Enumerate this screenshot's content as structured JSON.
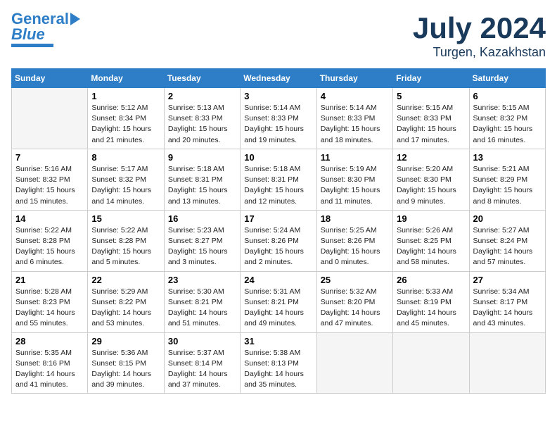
{
  "header": {
    "logo_line1": "General",
    "logo_line2": "Blue",
    "title": "July 2024",
    "subtitle": "Turgen, Kazakhstan"
  },
  "columns": [
    "Sunday",
    "Monday",
    "Tuesday",
    "Wednesday",
    "Thursday",
    "Friday",
    "Saturday"
  ],
  "weeks": [
    [
      {
        "day": "",
        "info": ""
      },
      {
        "day": "1",
        "info": "Sunrise: 5:12 AM\nSunset: 8:34 PM\nDaylight: 15 hours\nand 21 minutes."
      },
      {
        "day": "2",
        "info": "Sunrise: 5:13 AM\nSunset: 8:33 PM\nDaylight: 15 hours\nand 20 minutes."
      },
      {
        "day": "3",
        "info": "Sunrise: 5:14 AM\nSunset: 8:33 PM\nDaylight: 15 hours\nand 19 minutes."
      },
      {
        "day": "4",
        "info": "Sunrise: 5:14 AM\nSunset: 8:33 PM\nDaylight: 15 hours\nand 18 minutes."
      },
      {
        "day": "5",
        "info": "Sunrise: 5:15 AM\nSunset: 8:33 PM\nDaylight: 15 hours\nand 17 minutes."
      },
      {
        "day": "6",
        "info": "Sunrise: 5:15 AM\nSunset: 8:32 PM\nDaylight: 15 hours\nand 16 minutes."
      }
    ],
    [
      {
        "day": "7",
        "info": "Sunrise: 5:16 AM\nSunset: 8:32 PM\nDaylight: 15 hours\nand 15 minutes."
      },
      {
        "day": "8",
        "info": "Sunrise: 5:17 AM\nSunset: 8:32 PM\nDaylight: 15 hours\nand 14 minutes."
      },
      {
        "day": "9",
        "info": "Sunrise: 5:18 AM\nSunset: 8:31 PM\nDaylight: 15 hours\nand 13 minutes."
      },
      {
        "day": "10",
        "info": "Sunrise: 5:18 AM\nSunset: 8:31 PM\nDaylight: 15 hours\nand 12 minutes."
      },
      {
        "day": "11",
        "info": "Sunrise: 5:19 AM\nSunset: 8:30 PM\nDaylight: 15 hours\nand 11 minutes."
      },
      {
        "day": "12",
        "info": "Sunrise: 5:20 AM\nSunset: 8:30 PM\nDaylight: 15 hours\nand 9 minutes."
      },
      {
        "day": "13",
        "info": "Sunrise: 5:21 AM\nSunset: 8:29 PM\nDaylight: 15 hours\nand 8 minutes."
      }
    ],
    [
      {
        "day": "14",
        "info": "Sunrise: 5:22 AM\nSunset: 8:28 PM\nDaylight: 15 hours\nand 6 minutes."
      },
      {
        "day": "15",
        "info": "Sunrise: 5:22 AM\nSunset: 8:28 PM\nDaylight: 15 hours\nand 5 minutes."
      },
      {
        "day": "16",
        "info": "Sunrise: 5:23 AM\nSunset: 8:27 PM\nDaylight: 15 hours\nand 3 minutes."
      },
      {
        "day": "17",
        "info": "Sunrise: 5:24 AM\nSunset: 8:26 PM\nDaylight: 15 hours\nand 2 minutes."
      },
      {
        "day": "18",
        "info": "Sunrise: 5:25 AM\nSunset: 8:26 PM\nDaylight: 15 hours\nand 0 minutes."
      },
      {
        "day": "19",
        "info": "Sunrise: 5:26 AM\nSunset: 8:25 PM\nDaylight: 14 hours\nand 58 minutes."
      },
      {
        "day": "20",
        "info": "Sunrise: 5:27 AM\nSunset: 8:24 PM\nDaylight: 14 hours\nand 57 minutes."
      }
    ],
    [
      {
        "day": "21",
        "info": "Sunrise: 5:28 AM\nSunset: 8:23 PM\nDaylight: 14 hours\nand 55 minutes."
      },
      {
        "day": "22",
        "info": "Sunrise: 5:29 AM\nSunset: 8:22 PM\nDaylight: 14 hours\nand 53 minutes."
      },
      {
        "day": "23",
        "info": "Sunrise: 5:30 AM\nSunset: 8:21 PM\nDaylight: 14 hours\nand 51 minutes."
      },
      {
        "day": "24",
        "info": "Sunrise: 5:31 AM\nSunset: 8:21 PM\nDaylight: 14 hours\nand 49 minutes."
      },
      {
        "day": "25",
        "info": "Sunrise: 5:32 AM\nSunset: 8:20 PM\nDaylight: 14 hours\nand 47 minutes."
      },
      {
        "day": "26",
        "info": "Sunrise: 5:33 AM\nSunset: 8:19 PM\nDaylight: 14 hours\nand 45 minutes."
      },
      {
        "day": "27",
        "info": "Sunrise: 5:34 AM\nSunset: 8:17 PM\nDaylight: 14 hours\nand 43 minutes."
      }
    ],
    [
      {
        "day": "28",
        "info": "Sunrise: 5:35 AM\nSunset: 8:16 PM\nDaylight: 14 hours\nand 41 minutes."
      },
      {
        "day": "29",
        "info": "Sunrise: 5:36 AM\nSunset: 8:15 PM\nDaylight: 14 hours\nand 39 minutes."
      },
      {
        "day": "30",
        "info": "Sunrise: 5:37 AM\nSunset: 8:14 PM\nDaylight: 14 hours\nand 37 minutes."
      },
      {
        "day": "31",
        "info": "Sunrise: 5:38 AM\nSunset: 8:13 PM\nDaylight: 14 hours\nand 35 minutes."
      },
      {
        "day": "",
        "info": ""
      },
      {
        "day": "",
        "info": ""
      },
      {
        "day": "",
        "info": ""
      }
    ]
  ]
}
